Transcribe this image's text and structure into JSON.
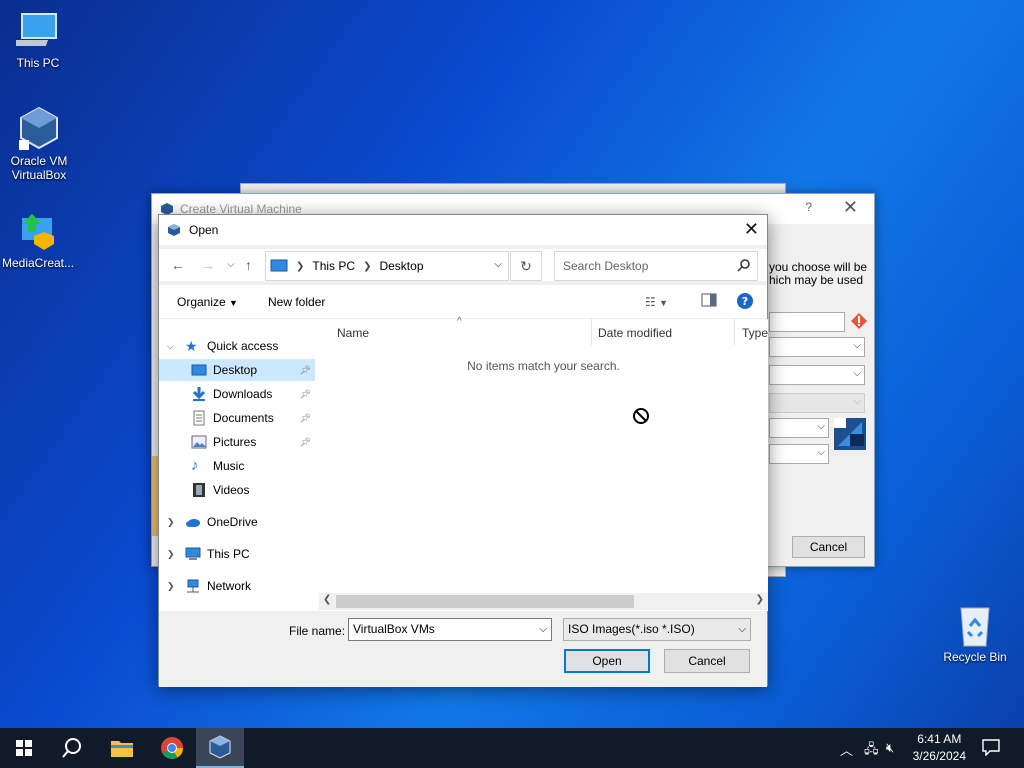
{
  "desktop": {
    "icons": [
      {
        "label": "This PC",
        "icon": "this-pc-icon"
      },
      {
        "label": "Oracle VM VirtualBox",
        "icon": "virtualbox-icon"
      },
      {
        "label": "MediaCreat...",
        "icon": "media-creation-tool-icon"
      },
      {
        "label": "Recycle Bin",
        "icon": "recycle-bin-icon"
      }
    ]
  },
  "create_vm_dialog": {
    "title": "Create Virtual Machine",
    "text_line1": "you choose will be",
    "text_line2": "hich may be used",
    "cancel_label": "Cancel"
  },
  "open_dialog": {
    "title": "Open",
    "address": {
      "segments": [
        "This PC",
        "Desktop"
      ]
    },
    "search_placeholder": "Search Desktop",
    "toolbar": {
      "organize": "Organize",
      "new_folder": "New folder"
    },
    "nav": {
      "quick_access": "Quick access",
      "items": [
        {
          "label": "Desktop",
          "pinned": true
        },
        {
          "label": "Downloads",
          "pinned": true
        },
        {
          "label": "Documents",
          "pinned": true
        },
        {
          "label": "Pictures",
          "pinned": true
        },
        {
          "label": "Music",
          "pinned": false
        },
        {
          "label": "Videos",
          "pinned": false
        }
      ],
      "onedrive": "OneDrive",
      "this_pc": "This PC",
      "network": "Network"
    },
    "columns": {
      "name": "Name",
      "date_modified": "Date modified",
      "type": "Type"
    },
    "empty_message": "No items match your search.",
    "file_name_label": "File name:",
    "file_name_value": "VirtualBox VMs",
    "file_type_value": "ISO Images(*.iso *.ISO)",
    "open_label": "Open",
    "cancel_label": "Cancel"
  },
  "taskbar": {
    "time": "6:41 AM",
    "date": "3/26/2024"
  },
  "colors": {
    "accent": "#0078d7",
    "selection": "#cce8ff",
    "taskbar": "#101a29"
  }
}
